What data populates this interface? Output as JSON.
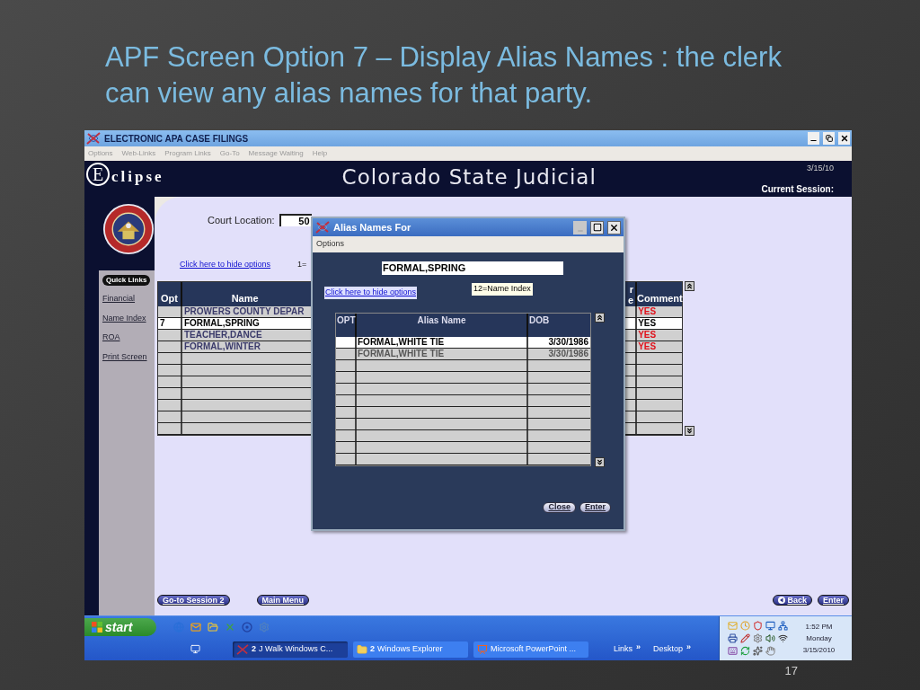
{
  "slide": {
    "title": "APF Screen Option 7 – Display Alias Names : the clerk can view any alias names for that party.",
    "page_number": "17"
  },
  "window": {
    "title": "ELECTRONIC APA CASE FILINGS"
  },
  "menu": [
    "Options",
    "Web-Links",
    "Program Links",
    "Go-To",
    "Message Waiting",
    "Help"
  ],
  "header": {
    "logo_initial": "E",
    "logo_text": "clipse",
    "title": "Colorado State Judicial",
    "date": "3/15/10",
    "session_label": "Current Session:"
  },
  "quick_links": {
    "title": "Quick Links",
    "items": [
      "Financial",
      "Name Index",
      "ROA",
      "Print Screen"
    ]
  },
  "court_location": {
    "label": "Court Location:",
    "value": "50"
  },
  "hide_options_link": "Click here to hide options",
  "option_hint": "1=",
  "parties_table": {
    "columns": [
      "Opt",
      "Name",
      "r e",
      "Comment"
    ],
    "rows": [
      {
        "opt": "",
        "name": "PROWERS COUNTY DEPAR",
        "comment": "YES",
        "selected": false
      },
      {
        "opt": "7",
        "name": "FORMAL,SPRING",
        "comment": "YES",
        "selected": true
      },
      {
        "opt": "",
        "name": "TEACHER,DANCE",
        "comment": "YES",
        "selected": false
      },
      {
        "opt": "",
        "name": "FORMAL,WINTER",
        "comment": "YES",
        "selected": false
      }
    ]
  },
  "dialog": {
    "title": "Alias Names For",
    "menu": [
      "Options"
    ],
    "name_value": "FORMAL,SPRING",
    "hide_options_link": "Click here to hide options",
    "option_hint": "12=Name Index",
    "table": {
      "columns": [
        "OPT",
        "Alias Name",
        "DOB"
      ],
      "rows": [
        {
          "opt": "",
          "name": "FORMAL,WHITE TIE",
          "dob": "3/30/1986",
          "selected": true
        },
        {
          "opt": "",
          "name": "FORMAL,WHITE TIE",
          "dob": "3/30/1986",
          "selected": false
        }
      ]
    },
    "buttons": [
      "Close",
      "Enter"
    ]
  },
  "left_buttons": [
    "Go-to Session 2",
    "Main Menu"
  ],
  "right_buttons": [
    {
      "label": "Back",
      "kind": "back"
    },
    {
      "label": "Enter",
      "kind": "plain"
    }
  ],
  "taskbar": {
    "start": "start",
    "tasks": [
      {
        "count": "2",
        "label": "J Walk Windows C...",
        "kind": "app",
        "selected": true
      },
      {
        "count": "2",
        "label": "Windows Explorer",
        "kind": "folder",
        "selected": false
      },
      {
        "label": "Microsoft PowerPoint ...",
        "kind": "slides",
        "selected": false
      }
    ],
    "toolbars": [
      {
        "label": "Links",
        "chevron": "»"
      },
      {
        "label": "Desktop",
        "chevron": "»"
      }
    ],
    "clock": {
      "time": "1:52 PM",
      "day": "Monday",
      "date": "3/15/2010"
    }
  }
}
